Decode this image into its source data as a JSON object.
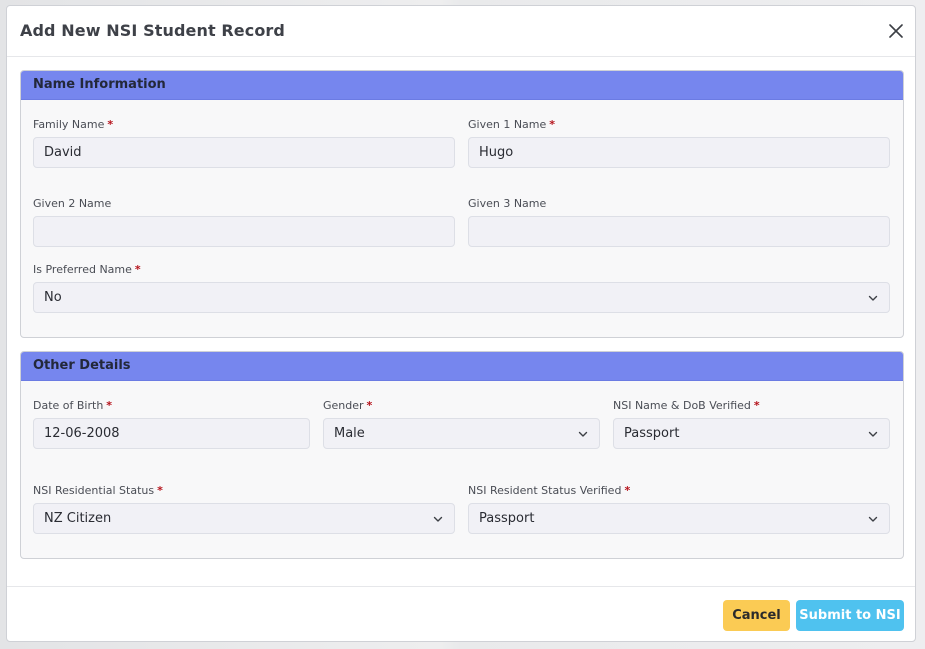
{
  "modal": {
    "title": "Add New NSI Student Record",
    "close_icon": "close-icon"
  },
  "name_section": {
    "title": "Name Information",
    "family_name": {
      "label": "Family Name",
      "required": "*",
      "value": "David"
    },
    "given1": {
      "label": "Given 1 Name",
      "required": "*",
      "value": "Hugo"
    },
    "given2": {
      "label": "Given 2 Name",
      "value": ""
    },
    "given3": {
      "label": "Given 3 Name",
      "value": ""
    },
    "preferred": {
      "label": "Is Preferred Name",
      "required": "*",
      "value": "No"
    }
  },
  "details_section": {
    "title": "Other Details",
    "dob": {
      "label": "Date of Birth",
      "required": "*",
      "value": "12-06-2008"
    },
    "gender": {
      "label": "Gender",
      "required": "*",
      "value": "Male"
    },
    "name_dob_verified": {
      "label": "NSI Name & DoB Verified",
      "required": "*",
      "value": "Passport"
    },
    "residential_status": {
      "label": "NSI Residential Status",
      "required": "*",
      "value": "NZ Citizen"
    },
    "resident_status_verified": {
      "label": "NSI Resident Status Verified",
      "required": "*",
      "value": "Passport"
    }
  },
  "footer": {
    "cancel_label": "Cancel",
    "submit_label": "Submit to NSI"
  },
  "colors": {
    "section_header": "#7686ee",
    "cancel_button": "#fbcb54",
    "submit_button": "#4fc2ef",
    "required_marker": "#b5121b"
  }
}
